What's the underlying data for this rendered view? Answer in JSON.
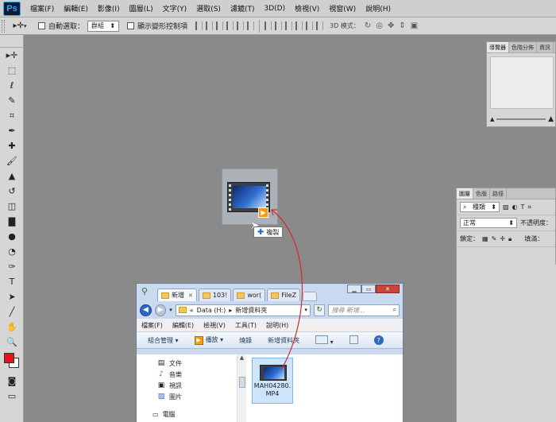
{
  "app": {
    "logo": "Ps"
  },
  "menu": [
    "檔案(F)",
    "編輯(E)",
    "影像(I)",
    "圖層(L)",
    "文字(Y)",
    "選取(S)",
    "濾鏡(T)",
    "3D(D)",
    "檢視(V)",
    "視窗(W)",
    "說明(H)"
  ],
  "options": {
    "auto_select_label": "自動選取：",
    "auto_select_value": "群組",
    "show_transform_label": "顯示變形控制項",
    "mode_3d_label": "3D 模式："
  },
  "tools": [
    "move-tool",
    "marquee-tool",
    "lasso-tool",
    "quick-select-tool",
    "crop-tool",
    "eyedropper-tool",
    "healing-brush-tool",
    "brush-tool",
    "clone-stamp-tool",
    "history-brush-tool",
    "eraser-tool",
    "gradient-tool",
    "blur-tool",
    "dodge-tool",
    "pen-tool",
    "type-tool",
    "path-select-tool",
    "shape-tool",
    "hand-tool",
    "zoom-tool"
  ],
  "tool_glyphs": [
    "▸✛",
    "⬚",
    "ℓ",
    "✎",
    "⌗",
    "✒",
    "✚",
    "🖌",
    "▲",
    "↺",
    "◫",
    "▇",
    "●",
    "◔",
    "✑",
    "T",
    "➤",
    "╱",
    "✋",
    "🔍"
  ],
  "colors": {
    "foreground": "#e8101b",
    "background": "#ffffff",
    "drag_arrow": "#d9262b"
  },
  "nav_panel": {
    "tabs": [
      "導覽器",
      "色階分佈",
      "資訊"
    ]
  },
  "layers_panel": {
    "tabs": [
      "圖層",
      "色版",
      "路徑"
    ],
    "filter_value": "種類",
    "blend_mode": "正常",
    "opacity_label": "不透明度：",
    "lock_label": "鎖定：",
    "fill_label": "填滿："
  },
  "drag": {
    "copy_label": "複製"
  },
  "explorer": {
    "tabs": [
      "新增",
      "103!",
      "wor(",
      "FileZ"
    ],
    "address_path": [
      "«",
      "Data (H:)",
      "▸",
      "新增資料夾"
    ],
    "search_placeholder": "搜尋 新增...",
    "menu": [
      "檔案(F)",
      "編輯(E)",
      "檢視(V)",
      "工具(T)",
      "說明(H)"
    ],
    "commands": {
      "organize": "組合管理",
      "play": "播放",
      "burn": "燒錄",
      "new_folder": "新增資料夾"
    },
    "nav_items": [
      "文件",
      "音樂",
      "視訊",
      "圖片"
    ],
    "nav_icons": [
      "document-icon",
      "music-icon",
      "video-icon",
      "picture-icon"
    ],
    "favorites_label": "電腦",
    "file": {
      "name_line1": "MAH04280.",
      "name_line2": "MP4"
    }
  }
}
